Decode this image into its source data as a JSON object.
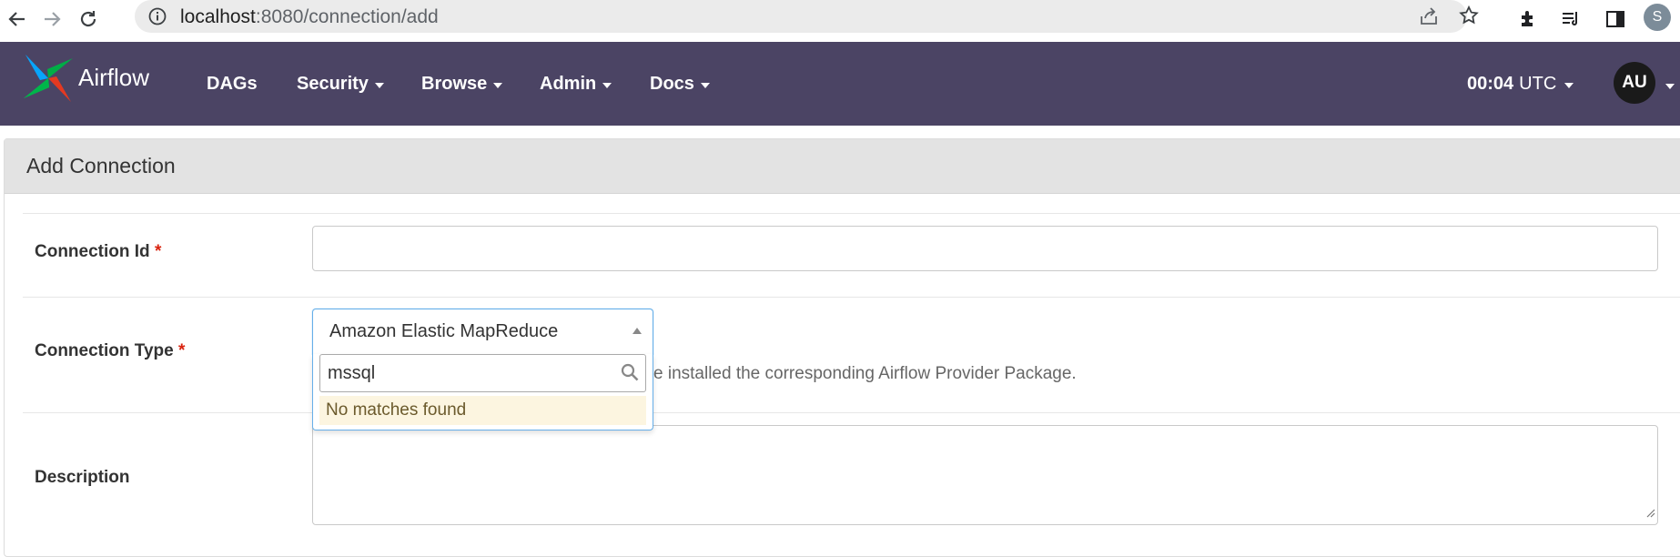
{
  "browser": {
    "url_host": "localhost",
    "url_rest": ":8080/connection/add",
    "profile_initial": "S"
  },
  "navbar": {
    "brand": "Airflow",
    "menu": [
      {
        "label": "DAGs",
        "has_caret": false
      },
      {
        "label": "Security",
        "has_caret": true
      },
      {
        "label": "Browse",
        "has_caret": true
      },
      {
        "label": "Admin",
        "has_caret": true
      },
      {
        "label": "Docs",
        "has_caret": true
      }
    ],
    "time": "00:04",
    "timezone": "UTC",
    "user_initials": "AU"
  },
  "page": {
    "title": "Add Connection",
    "fields": {
      "conn_id": {
        "label": "Connection Id",
        "required_mark": "*",
        "value": ""
      },
      "conn_type": {
        "label": "Connection Type",
        "required_mark": "*",
        "selected": "Amazon Elastic MapReduce",
        "search_value": "mssql",
        "no_results": "No matches found",
        "help_text_visible": "e installed the corresponding Airflow Provider Package."
      },
      "description": {
        "label": "Description",
        "value": ""
      }
    }
  },
  "colors": {
    "navbar_bg": "#4b4464",
    "required": "#d9230f",
    "focus_border": "#66afe9",
    "no_match_bg": "#fcf5e0"
  }
}
